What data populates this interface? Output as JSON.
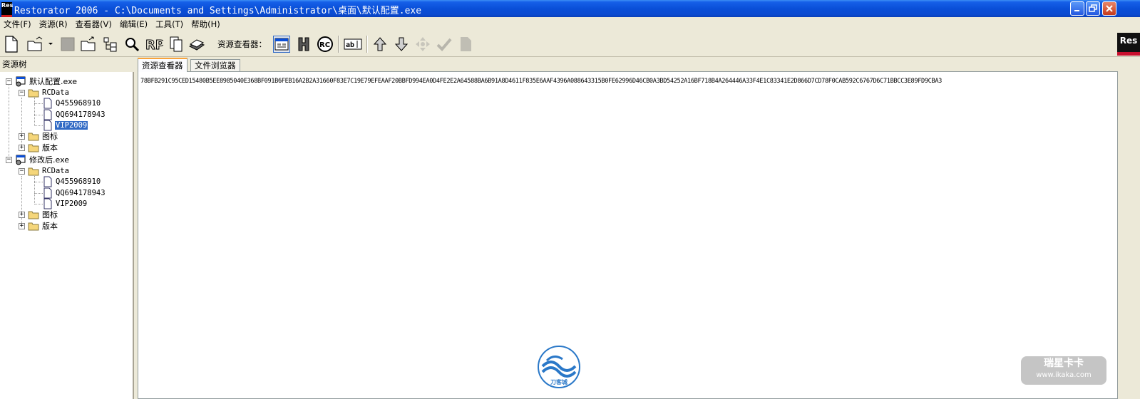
{
  "window": {
    "title": "Restorator 2006 - C:\\Documents and Settings\\Administrator\\桌面\\默认配置.exe",
    "logo_text": "Res"
  },
  "menu": [
    {
      "label": "文件(F)"
    },
    {
      "label": "资源(R)"
    },
    {
      "label": "查看器(V)"
    },
    {
      "label": "编辑(E)"
    },
    {
      "label": "工具(T)"
    },
    {
      "label": "帮助(H)"
    }
  ],
  "toolbar": {
    "viewer_label": "资源查看器：",
    "logo_text": "Res"
  },
  "tree": {
    "header": "资源树",
    "files": [
      {
        "name": "默认配置.exe",
        "folders": [
          {
            "name": "RCData",
            "expanded": true,
            "items": [
              "Q455968910",
              "QQ694178943",
              "VIP2009"
            ]
          },
          {
            "name": "图标",
            "expanded": false
          },
          {
            "name": "版本",
            "expanded": false
          }
        ]
      },
      {
        "name": "修改后.exe",
        "folders": [
          {
            "name": "RCData",
            "expanded": true,
            "items": [
              "Q455968910",
              "QQ694178943",
              "VIP2009"
            ]
          },
          {
            "name": "图标",
            "expanded": false
          },
          {
            "name": "版本",
            "expanded": false
          }
        ]
      }
    ],
    "selected": "VIP2009"
  },
  "tabs": [
    {
      "label": "资源查看器",
      "active": true
    },
    {
      "label": "文件浏览器",
      "active": false
    }
  ],
  "content": {
    "hex": "78BFB291C95CED15480B5EE8985040E368BF091B6FEB16A2B2A31660F83E7C19E79EFEAAF20BBFD994EA0D4FE2E2A64588BA6B91A8D4611F835E6AAF4396A088643315B0FE62996D46CB0A3BD54252A16BF718B4A264446A33F4E1C83341E2D866D7CD78F0CAB592C6767D6C71BBCC3E89FD9CBA3"
  },
  "watermarks": {
    "center_logo_text": "刀客城",
    "ikaka_line1": "瑞星卡卡",
    "ikaka_line2": "www.ikaka.com"
  }
}
